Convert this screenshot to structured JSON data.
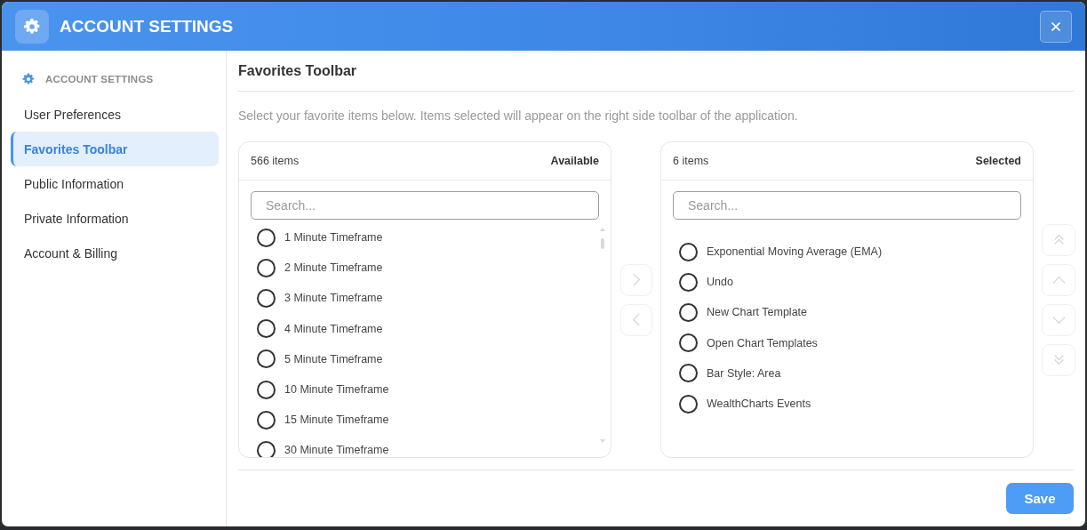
{
  "window": {
    "title": "ACCOUNT SETTINGS"
  },
  "sidebar": {
    "heading": "ACCOUNT SETTINGS",
    "items": [
      {
        "label": "User Preferences",
        "selected": false
      },
      {
        "label": "Favorites Toolbar",
        "selected": true
      },
      {
        "label": "Public Information",
        "selected": false
      },
      {
        "label": "Private Information",
        "selected": false
      },
      {
        "label": "Account & Billing",
        "selected": false
      }
    ]
  },
  "content": {
    "title": "Favorites Toolbar",
    "description": "Select your favorite items below. Items selected will appear on the right side toolbar of the application.",
    "available": {
      "count": "566 items",
      "label": "Available",
      "search": {
        "placeholder": "Search..."
      },
      "items": [
        {
          "label": "1 Minute Timeframe",
          "checked": false
        },
        {
          "label": "2 Minute Timeframe",
          "checked": false
        },
        {
          "label": "3 Minute Timeframe",
          "checked": false
        },
        {
          "label": "4 Minute Timeframe",
          "checked": false
        },
        {
          "label": "5 Minute Timeframe",
          "checked": false
        },
        {
          "label": "10 Minute Timeframe",
          "checked": false
        },
        {
          "label": "15 Minute Timeframe",
          "checked": false
        },
        {
          "label": "30 Minute Timeframe",
          "checked": false
        }
      ]
    },
    "transfer_buttons": [
      {
        "kind": "right",
        "disabled": true
      },
      {
        "kind": "left",
        "disabled": true
      }
    ],
    "selected": {
      "count": "6 items",
      "label": "Selected",
      "search": {
        "placeholder": "Search..."
      },
      "items": [
        {
          "label": "Exponential Moving Average (EMA)",
          "checked": false
        },
        {
          "label": "Undo",
          "checked": false
        },
        {
          "label": "New Chart Template",
          "checked": false
        },
        {
          "label": "Open Chart Templates",
          "checked": false
        },
        {
          "label": "Bar Style: Area",
          "checked": false
        },
        {
          "label": "WealthCharts Events",
          "checked": false
        }
      ]
    },
    "order_buttons": [
      {
        "kind": "top",
        "disabled": true
      },
      {
        "kind": "up",
        "disabled": true
      },
      {
        "kind": "down",
        "disabled": true
      },
      {
        "kind": "bottom",
        "disabled": true
      }
    ]
  },
  "footer": {
    "save": "Save"
  }
}
